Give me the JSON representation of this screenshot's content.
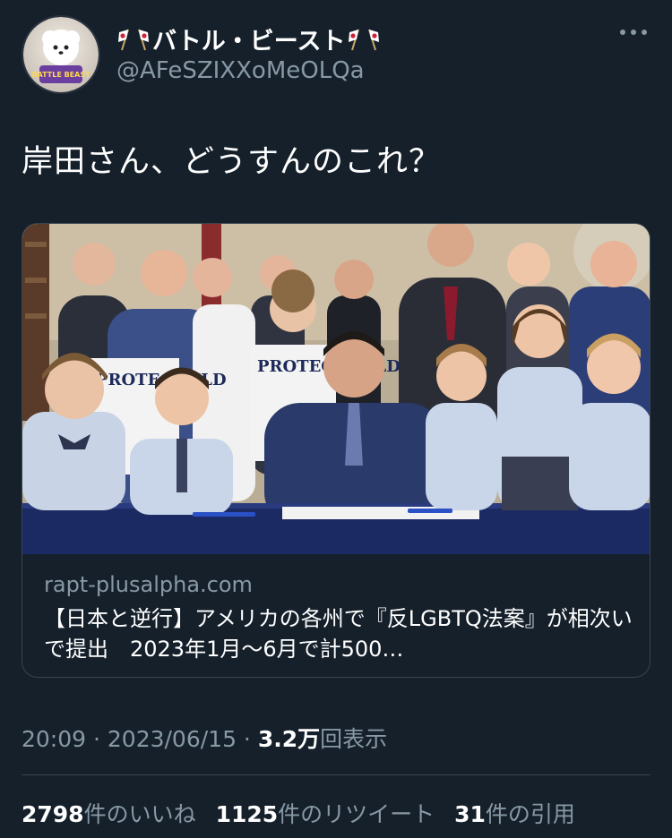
{
  "author": {
    "display_name": "バトル・ビースト",
    "handle": "@AFeSZIXXoMeOLQa",
    "avatar_text": "BATTLE BEAST"
  },
  "tweet": {
    "text": "岸田さん、どうすんのこれ？"
  },
  "card": {
    "domain": "rapt-plusalpha.com",
    "title": "【日本と逆行】アメリカの各州で『反LGBTQ法案』が相次いで提出　2023年1月〜6月で計500…",
    "sign_text_1": "PROTE CHILD",
    "sign_text_2": "PROTEC CHILD"
  },
  "meta": {
    "time": "20:09",
    "sep1": " · ",
    "date": "2023/06/15",
    "sep2": " · ",
    "views_count": "3.2万",
    "views_label": "回表示"
  },
  "stats": {
    "likes_count": "2798",
    "likes_label": "件のいいね",
    "retweets_count": "1125",
    "retweets_label": "件のリツイート",
    "quotes_count": "31",
    "quotes_label": "件の引用"
  },
  "colors": {
    "background": "#15202b",
    "secondary_text": "#8899a6",
    "border": "#38444d"
  },
  "icons": {
    "more": "more-icon",
    "flag": "japan-flag-icon"
  }
}
